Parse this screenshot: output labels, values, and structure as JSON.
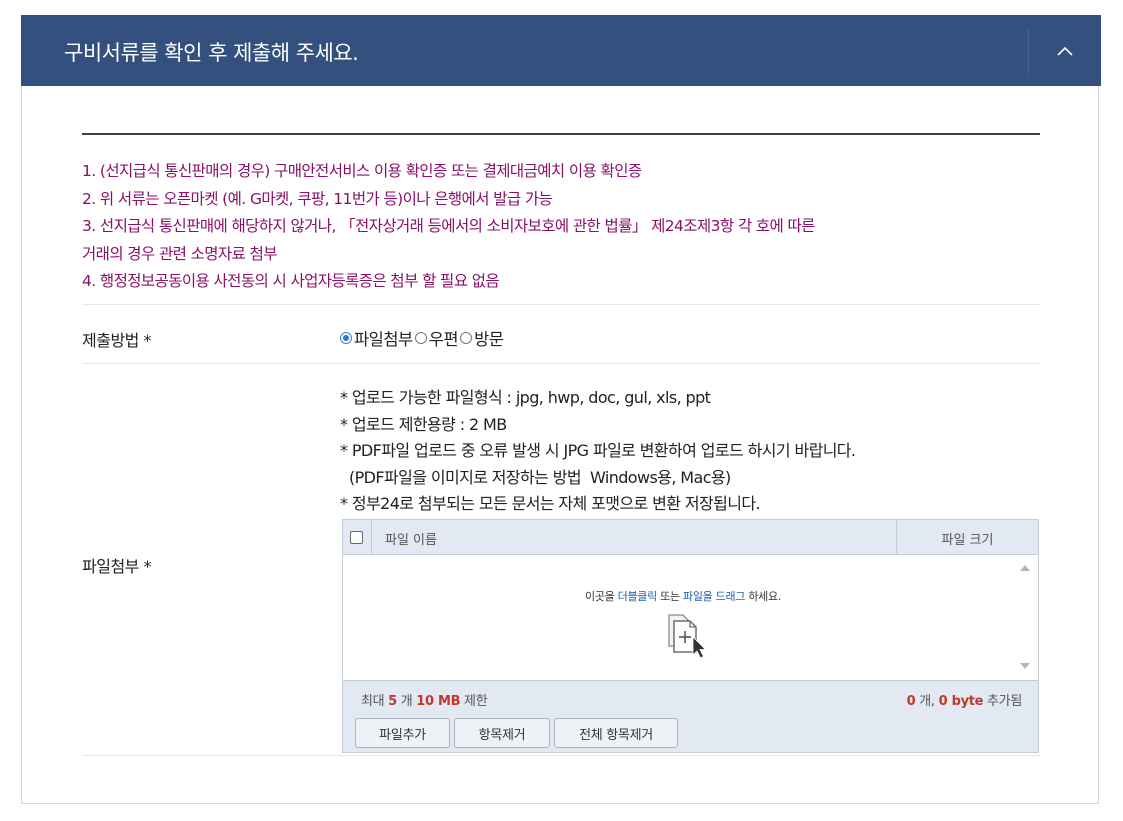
{
  "header": {
    "title": "구비서류를 확인 후 제출해 주세요."
  },
  "notice": {
    "lines": [
      "1. (선지급식 통신판매의 경우) 구매안전서비스 이용 확인증 또는 결제대금예치 이용 확인증",
      "2. 위 서류는 오픈마켓 (예. G마켓, 쿠팡, 11번가 등)이나 은행에서 발급 가능",
      "3. 선지급식 통신판매에 해당하지 않거나, 「전자상거래 등에서의 소비자보호에 관한 법률」 제24조제3항 각 호에 따른",
      "거래의 경우 관련 소명자료 첨부",
      "4. 행정정보공동이용 사전동의 시 사업자등록증은 첨부 할 필요 없음"
    ],
    "color": "#8a1068"
  },
  "submit_method": {
    "label": "제출방법 *",
    "options": [
      "파일첨부",
      "우편",
      "방문"
    ],
    "selected": "파일첨부"
  },
  "attachment": {
    "label": "파일첨부 *",
    "guide": [
      "* 업로드 가능한 파일형식 : jpg, hwp, doc, gul, xls, ppt",
      "* 업로드 제한용량 : 2 MB",
      "* PDF파일 업로드 중 오류 발생 시 JPG 파일로 변환하여 업로드 하시기 바랍니다.",
      "  (PDF파일을 이미지로 저장하는 방법  Windows용, Mac용)",
      "* 정부24로 첨부되는 모든 문서는 자체 포맷으로 변환 저장됩니다."
    ]
  },
  "uploader": {
    "col_name": "파일 이름",
    "col_size": "파일 크기",
    "drop_prefix": "이곳을 ",
    "drop_dblclick": "더블클릭",
    "drop_mid": " 또는 ",
    "drop_drag": "파일을 드래그",
    "drop_suffix": " 하세요.",
    "limit_prefix": "최대 ",
    "limit_count": "5",
    "limit_mid": " 개 ",
    "limit_size": "10 MB",
    "limit_suffix": " 제한",
    "added_count": "0",
    "added_mid": " 개, ",
    "added_size": "0 byte",
    "added_suffix": " 추가됨",
    "buttons": {
      "add": "파일추가",
      "remove": "항목제거",
      "remove_all": "전체 항목제거"
    }
  },
  "colors": {
    "header_bg": "#34507f",
    "accent_blue": "#1e5fae",
    "limit_red": "#c0392b"
  }
}
